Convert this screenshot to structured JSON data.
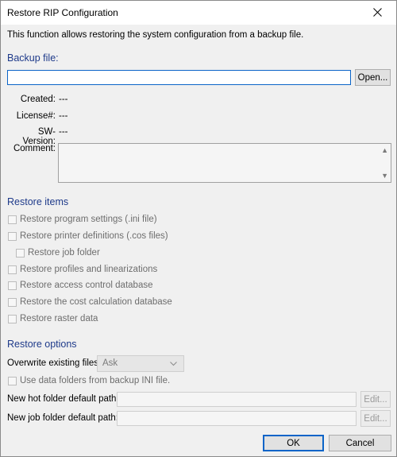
{
  "window": {
    "title": "Restore RIP Configuration"
  },
  "description": "This function allows restoring the system configuration from a backup file.",
  "backup": {
    "section_title": "Backup file:",
    "file_value": "",
    "open_button": "Open...",
    "created_label": "Created:",
    "created_value": "---",
    "license_label": "License#:",
    "license_value": "---",
    "sw_label": "SW-Version:",
    "sw_value": "---",
    "comment_label": "Comment:",
    "comment_value": ""
  },
  "restore_items": {
    "section_title": "Restore items",
    "items": [
      {
        "label": "Restore program settings (.ini file)",
        "checked": false,
        "enabled": false
      },
      {
        "label": "Restore printer definitions (.cos files)",
        "checked": false,
        "enabled": false
      },
      {
        "label": "Restore job folder",
        "checked": false,
        "enabled": false
      },
      {
        "label": "Restore profiles and linearizations",
        "checked": false,
        "enabled": false
      },
      {
        "label": "Restore access control database",
        "checked": false,
        "enabled": false
      },
      {
        "label": "Restore the cost calculation database",
        "checked": false,
        "enabled": false
      },
      {
        "label": "Restore raster data",
        "checked": false,
        "enabled": false
      }
    ]
  },
  "restore_options": {
    "section_title": "Restore options",
    "overwrite_label": "Overwrite existing files:",
    "overwrite_value": "Ask",
    "use_data_folders_label": "Use data folders from backup INI file.",
    "hot_folder_label": "New hot folder default path:",
    "hot_folder_value": "",
    "job_folder_label": "New job folder default path:",
    "job_folder_value": "",
    "edit_button": "Edit..."
  },
  "footer": {
    "ok_button": "OK",
    "cancel_button": "Cancel"
  },
  "colors": {
    "section_title": "#1e3a8a",
    "focus_border": "#0a64c8",
    "disabled_text": "#6d6d6d"
  }
}
